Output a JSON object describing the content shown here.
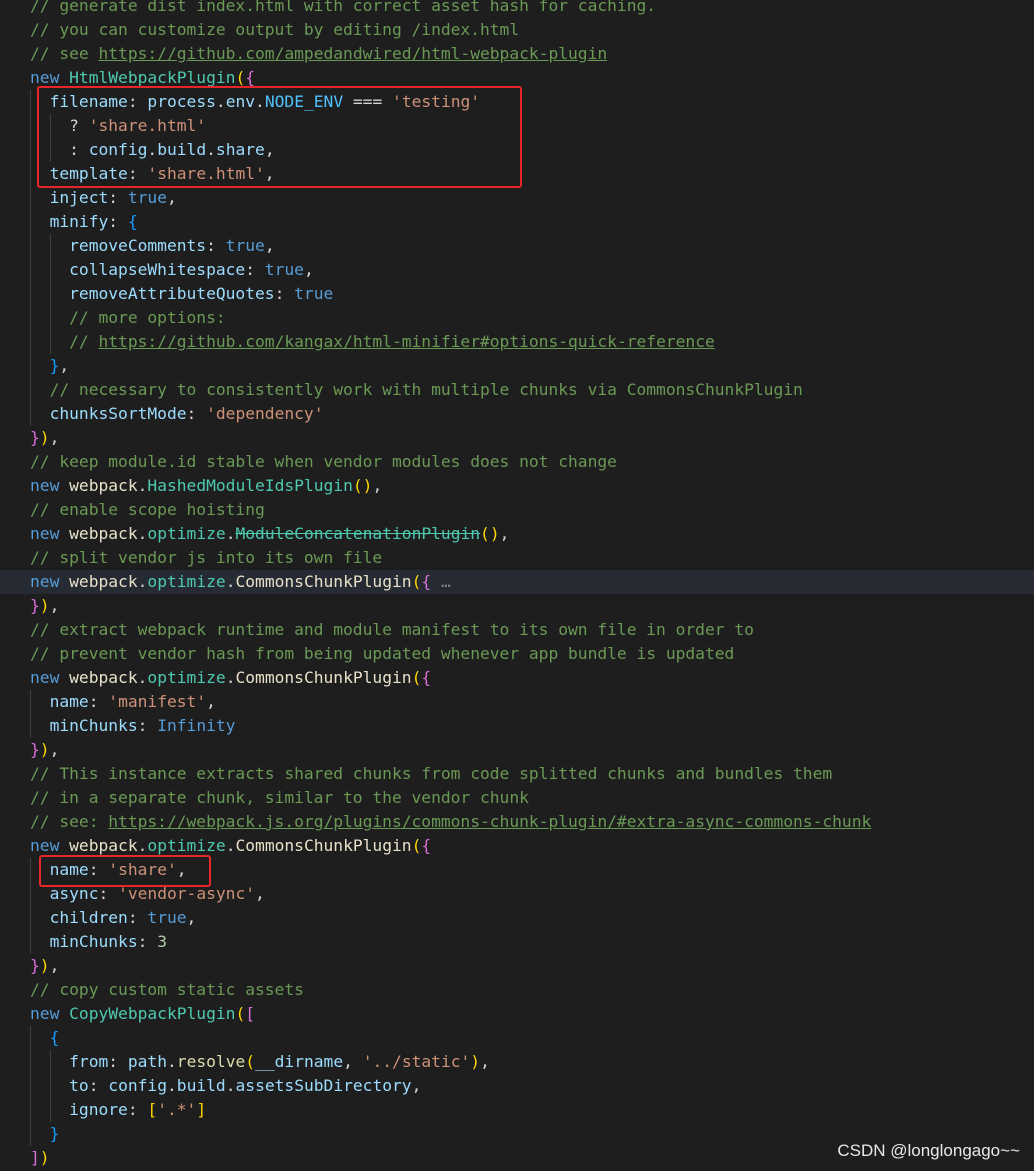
{
  "colors": {
    "background": "#1e1e1e",
    "comment": "#6a9955",
    "keyword": "#569cd6",
    "class": "#4ec9b0",
    "string": "#ce9178",
    "highlight_box": "#e8262a"
  },
  "current_line": 25,
  "highlighted_ranges": [
    [
      5,
      8
    ],
    [
      37,
      37
    ]
  ],
  "watermark": "CSDN @longlongago~~",
  "lines": [
    [
      [
        "c",
        "// generate dist index.html with correct asset hash for caching."
      ]
    ],
    [
      [
        "c",
        "// you can customize output by editing /index.html"
      ]
    ],
    [
      [
        "c",
        "// see "
      ],
      [
        "u",
        "https://github.com/ampedandwired/html-webpack-plugin"
      ]
    ],
    [
      [
        "k",
        "new "
      ],
      [
        "cl",
        "HtmlWebpackPlugin"
      ],
      [
        "y",
        "("
      ],
      [
        "m",
        "{"
      ]
    ],
    [
      [
        "p",
        "  filename"
      ],
      [
        "t",
        ": "
      ],
      [
        "p",
        "process"
      ],
      [
        "t",
        "."
      ],
      [
        "p",
        "env"
      ],
      [
        "t",
        "."
      ],
      [
        "cn",
        "NODE_ENV"
      ],
      [
        "t",
        " === "
      ],
      [
        "s",
        "'testing'"
      ]
    ],
    [
      [
        "t",
        "    ? "
      ],
      [
        "s",
        "'share.html'"
      ]
    ],
    [
      [
        "t",
        "    : "
      ],
      [
        "p",
        "config"
      ],
      [
        "t",
        "."
      ],
      [
        "p",
        "build"
      ],
      [
        "t",
        "."
      ],
      [
        "p",
        "share"
      ],
      [
        "t",
        ","
      ]
    ],
    [
      [
        "p",
        "  template"
      ],
      [
        "t",
        ": "
      ],
      [
        "s",
        "'share.html'"
      ],
      [
        "t",
        ","
      ]
    ],
    [
      [
        "p",
        "  inject"
      ],
      [
        "t",
        ": "
      ],
      [
        "k",
        "true"
      ],
      [
        "t",
        ","
      ]
    ],
    [
      [
        "p",
        "  minify"
      ],
      [
        "t",
        ": "
      ],
      [
        "b",
        "{"
      ]
    ],
    [
      [
        "p",
        "    removeComments"
      ],
      [
        "t",
        ": "
      ],
      [
        "k",
        "true"
      ],
      [
        "t",
        ","
      ]
    ],
    [
      [
        "p",
        "    collapseWhitespace"
      ],
      [
        "t",
        ": "
      ],
      [
        "k",
        "true"
      ],
      [
        "t",
        ","
      ]
    ],
    [
      [
        "p",
        "    removeAttributeQuotes"
      ],
      [
        "t",
        ": "
      ],
      [
        "k",
        "true"
      ]
    ],
    [
      [
        "c",
        "    // more options:"
      ]
    ],
    [
      [
        "c",
        "    // "
      ],
      [
        "u",
        "https://github.com/kangax/html-minifier#options-quick-reference"
      ]
    ],
    [
      [
        "t",
        "  "
      ],
      [
        "b",
        "}"
      ],
      [
        "t",
        ","
      ]
    ],
    [
      [
        "c",
        "  // necessary to consistently work with multiple chunks via CommonsChunkPlugin"
      ]
    ],
    [
      [
        "p",
        "  chunksSortMode"
      ],
      [
        "t",
        ": "
      ],
      [
        "s",
        "'dependency'"
      ]
    ],
    [
      [
        "m",
        "}"
      ],
      [
        "y",
        ")"
      ],
      [
        "t",
        ","
      ]
    ],
    [
      [
        "c",
        "// keep module.id stable when vendor modules does not change"
      ]
    ],
    [
      [
        "k",
        "new "
      ],
      [
        "v",
        "webpack"
      ],
      [
        "t",
        "."
      ],
      [
        "cl",
        "HashedModuleIdsPlugin"
      ],
      [
        "y",
        "()"
      ],
      [
        "t",
        ","
      ]
    ],
    [
      [
        "c",
        "// enable scope hoisting"
      ]
    ],
    [
      [
        "k",
        "new "
      ],
      [
        "v",
        "webpack"
      ],
      [
        "t",
        "."
      ],
      [
        "cl",
        "optimize"
      ],
      [
        "t",
        "."
      ],
      [
        "st",
        "ModuleConcatenationPlugin"
      ],
      [
        "y",
        "()"
      ],
      [
        "t",
        ","
      ]
    ],
    [
      [
        "c",
        "// split vendor js into its own file"
      ]
    ],
    [
      [
        "k",
        "new "
      ],
      [
        "v",
        "webpack"
      ],
      [
        "t",
        "."
      ],
      [
        "cl",
        "optimize"
      ],
      [
        "t",
        "."
      ],
      [
        "v",
        "CommonsChunkPlugin"
      ],
      [
        "y",
        "("
      ],
      [
        "m",
        "{"
      ],
      [
        "e",
        " …"
      ]
    ],
    [
      [
        "m",
        "}"
      ],
      [
        "y",
        ")"
      ],
      [
        "t",
        ","
      ]
    ],
    [
      [
        "c",
        "// extract webpack runtime and module manifest to its own file in order to"
      ]
    ],
    [
      [
        "c",
        "// prevent vendor hash from being updated whenever app bundle is updated"
      ]
    ],
    [
      [
        "k",
        "new "
      ],
      [
        "v",
        "webpack"
      ],
      [
        "t",
        "."
      ],
      [
        "cl",
        "optimize"
      ],
      [
        "t",
        "."
      ],
      [
        "v",
        "CommonsChunkPlugin"
      ],
      [
        "y",
        "("
      ],
      [
        "m",
        "{"
      ]
    ],
    [
      [
        "p",
        "  name"
      ],
      [
        "t",
        ": "
      ],
      [
        "s",
        "'manifest'"
      ],
      [
        "t",
        ","
      ]
    ],
    [
      [
        "p",
        "  minChunks"
      ],
      [
        "t",
        ": "
      ],
      [
        "k",
        "Infinity"
      ]
    ],
    [
      [
        "m",
        "}"
      ],
      [
        "y",
        ")"
      ],
      [
        "t",
        ","
      ]
    ],
    [
      [
        "c",
        "// This instance extracts shared chunks from code splitted chunks and bundles them"
      ]
    ],
    [
      [
        "c",
        "// in a separate chunk, similar to the vendor chunk"
      ]
    ],
    [
      [
        "c",
        "// see: "
      ],
      [
        "u",
        "https://webpack.js.org/plugins/commons-chunk-plugin/#extra-async-commons-chunk"
      ]
    ],
    [
      [
        "k",
        "new "
      ],
      [
        "v",
        "webpack"
      ],
      [
        "t",
        "."
      ],
      [
        "cl",
        "optimize"
      ],
      [
        "t",
        "."
      ],
      [
        "v",
        "CommonsChunkPlugin"
      ],
      [
        "y",
        "("
      ],
      [
        "m",
        "{"
      ]
    ],
    [
      [
        "p",
        "  name"
      ],
      [
        "t",
        ": "
      ],
      [
        "s",
        "'share'"
      ],
      [
        "t",
        ","
      ]
    ],
    [
      [
        "p",
        "  async"
      ],
      [
        "t",
        ": "
      ],
      [
        "s",
        "'vendor-async'"
      ],
      [
        "t",
        ","
      ]
    ],
    [
      [
        "p",
        "  children"
      ],
      [
        "t",
        ": "
      ],
      [
        "k",
        "true"
      ],
      [
        "t",
        ","
      ]
    ],
    [
      [
        "p",
        "  minChunks"
      ],
      [
        "t",
        ": "
      ],
      [
        "n",
        "3"
      ]
    ],
    [
      [
        "m",
        "}"
      ],
      [
        "y",
        ")"
      ],
      [
        "t",
        ","
      ]
    ],
    [
      [
        "c",
        "// copy custom static assets"
      ]
    ],
    [
      [
        "k",
        "new "
      ],
      [
        "cl",
        "CopyWebpackPlugin"
      ],
      [
        "y",
        "("
      ],
      [
        "m",
        "["
      ]
    ],
    [
      [
        "t",
        "  "
      ],
      [
        "b",
        "{"
      ]
    ],
    [
      [
        "p",
        "    from"
      ],
      [
        "t",
        ": "
      ],
      [
        "p",
        "path"
      ],
      [
        "t",
        "."
      ],
      [
        "f",
        "resolve"
      ],
      [
        "y",
        "("
      ],
      [
        "p",
        "__dirname"
      ],
      [
        "t",
        ", "
      ],
      [
        "s",
        "'../static'"
      ],
      [
        "y",
        ")"
      ],
      [
        "t",
        ","
      ]
    ],
    [
      [
        "p",
        "    to"
      ],
      [
        "t",
        ": "
      ],
      [
        "p",
        "config"
      ],
      [
        "t",
        "."
      ],
      [
        "p",
        "build"
      ],
      [
        "t",
        "."
      ],
      [
        "p",
        "assetsSubDirectory"
      ],
      [
        "t",
        ","
      ]
    ],
    [
      [
        "p",
        "    ignore"
      ],
      [
        "t",
        ": "
      ],
      [
        "y",
        "["
      ],
      [
        "s",
        "'.*'"
      ],
      [
        "y",
        "]"
      ]
    ],
    [
      [
        "t",
        "  "
      ],
      [
        "b",
        "}"
      ]
    ],
    [
      [
        "m",
        "]"
      ],
      [
        "y",
        ")"
      ]
    ]
  ]
}
